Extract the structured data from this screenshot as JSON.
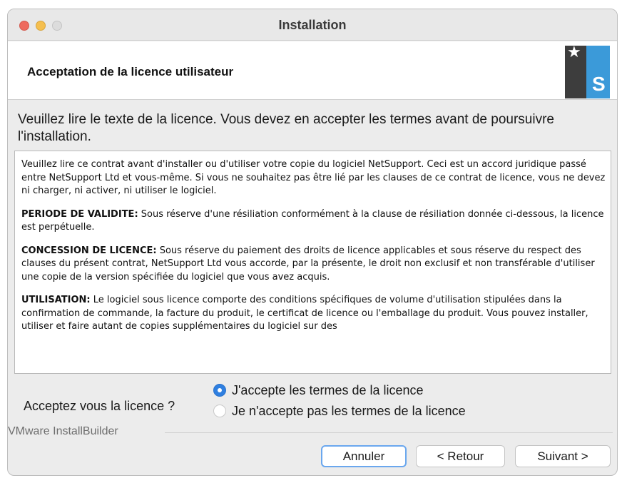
{
  "window": {
    "title": "Installation"
  },
  "header": {
    "title": "Acceptation de la licence utilisateur"
  },
  "instruction": "Veuillez lire le texte de la licence. Vous devez en accepter les termes avant de poursuivre l'installation.",
  "license": {
    "intro": "Veuillez lire ce contrat avant d'installer ou d'utiliser votre copie du logiciel NetSupport. Ceci est un accord juridique passé entre NetSupport Ltd et vous-même. Si vous ne souhaitez pas être lié par les clauses de ce contrat de licence, vous ne devez ni charger, ni activer, ni utiliser le logiciel.",
    "sections": [
      {
        "heading": "PERIODE DE VALIDITE:",
        "text": " Sous réserve d'une résiliation conformément à la clause de résiliation donnée ci-dessous, la licence est perpétuelle."
      },
      {
        "heading": "CONCESSION DE LICENCE:",
        "text": " Sous réserve du paiement des droits de licence applicables et sous réserve du respect des clauses du présent contrat, NetSupport Ltd vous accorde, par la présente, le droit non exclusif et non transférable d'utiliser une copie de la version spécifiée du logiciel que vous avez acquis."
      },
      {
        "heading": "UTILISATION:",
        "text": " Le logiciel sous licence comporte des conditions spécifiques de volume d'utilisation stipulées dans la confirmation de commande, la facture du produit, le certificat de licence ou l'emballage du produit. Vous pouvez installer, utiliser et faire autant de copies supplémentaires du logiciel sur des"
      }
    ]
  },
  "acceptance": {
    "question": "Acceptez vous la licence ?",
    "options": [
      {
        "label": "J'accepte les termes de la licence",
        "selected": true
      },
      {
        "label": "Je n'accepte pas les termes de la licence",
        "selected": false
      }
    ]
  },
  "footer": {
    "vendor": "VMware InstallBuilder"
  },
  "buttons": {
    "cancel": "Annuler",
    "back": "< Retour",
    "next": "Suivant >"
  },
  "colors": {
    "accent": "#2f7fe0",
    "logo_blue": "#3b9ad9",
    "logo_dark": "#3d3d3d"
  },
  "icons": {
    "logo": "netsupport-logo-icon"
  }
}
